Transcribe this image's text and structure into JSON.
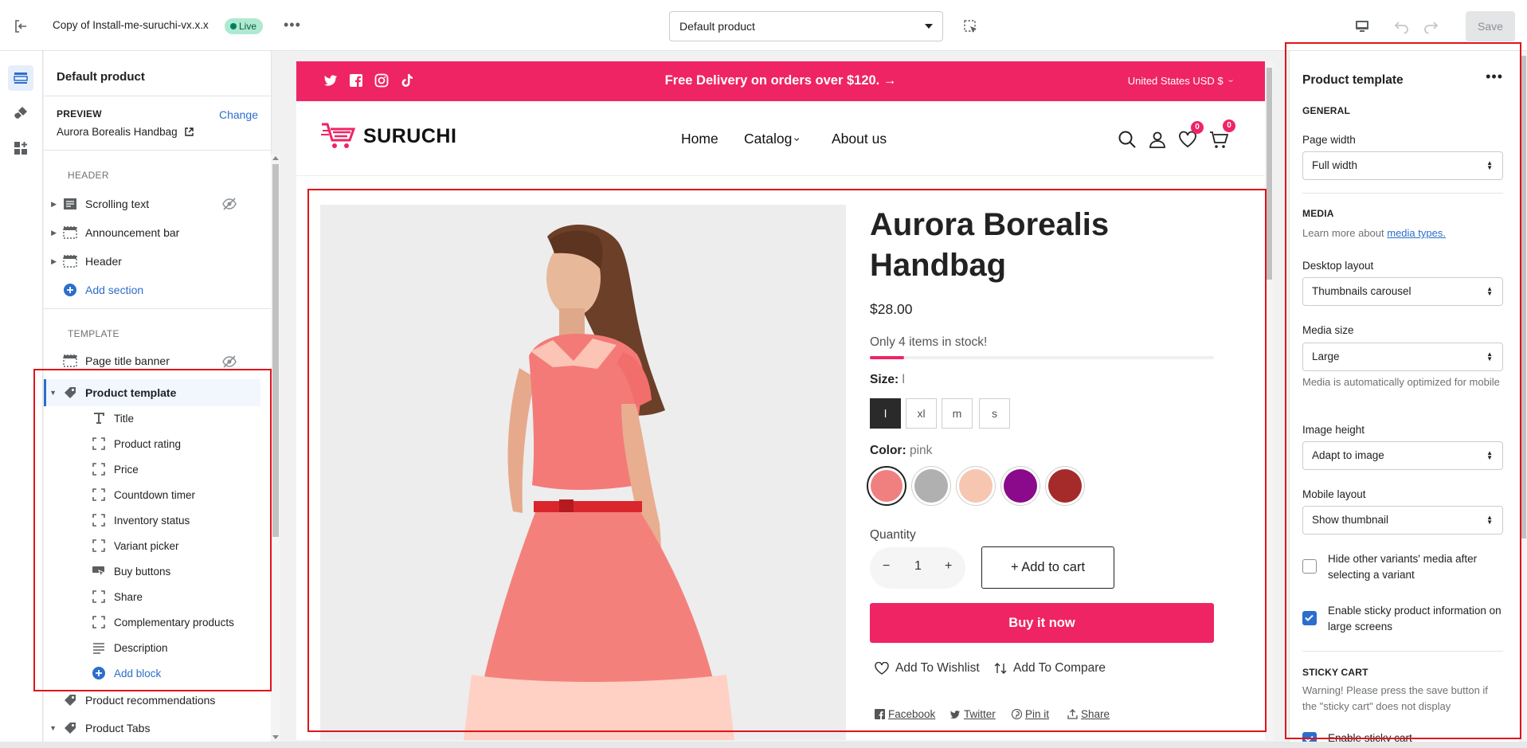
{
  "topbar": {
    "theme_title": "Copy of Install-me-suruchi-vx.x.x",
    "status": "Live",
    "template_select": "Default product",
    "save_label": "Save"
  },
  "left": {
    "heading": "Default product",
    "preview_label": "PREVIEW",
    "change_label": "Change",
    "preview_product": "Aurora Borealis Handbag",
    "header_label": "HEADER",
    "header_items": [
      {
        "label": "Scrolling text",
        "icon": "section-icon"
      },
      {
        "label": "Announcement bar",
        "icon": "section-header-icon"
      },
      {
        "label": "Header",
        "icon": "section-header-icon"
      }
    ],
    "add_section": "Add section",
    "template_label": "TEMPLATE",
    "template_items": [
      {
        "label": "Page title banner"
      },
      {
        "label": "Product template"
      }
    ],
    "blocks": [
      {
        "label": "Title",
        "icon": "text-icon"
      },
      {
        "label": "Product rating",
        "icon": "block-icon"
      },
      {
        "label": "Price",
        "icon": "block-icon"
      },
      {
        "label": "Countdown timer",
        "icon": "block-icon"
      },
      {
        "label": "Inventory status",
        "icon": "block-icon"
      },
      {
        "label": "Variant picker",
        "icon": "block-icon"
      },
      {
        "label": "Buy buttons",
        "icon": "buy-buttons-icon"
      },
      {
        "label": "Share",
        "icon": "block-icon"
      },
      {
        "label": "Complementary products",
        "icon": "block-icon"
      },
      {
        "label": "Description",
        "icon": "description-icon"
      }
    ],
    "add_block": "Add block",
    "after_items": [
      {
        "label": "Product recommendations"
      },
      {
        "label": "Product Tabs"
      }
    ]
  },
  "store": {
    "announcement": "Free Delivery on orders over $120.  →",
    "currency": "United States USD $",
    "logo": "SURUCHI",
    "nav": [
      "Home",
      "Catalog",
      "About us"
    ],
    "wishlist_count": "0",
    "cart_count": "0",
    "product": {
      "title_line1": "Aurora Borealis",
      "title_line2": "Handbag",
      "price": "$28.00",
      "stock_text": "Only 4 items in stock!",
      "stock_fraction": 0.1,
      "size_label": "Size:",
      "size_value": "l",
      "sizes": [
        "l",
        "xl",
        "m",
        "s"
      ],
      "color_label": "Color:",
      "color_value": "pink",
      "swatches": [
        "#f08080",
        "#b0b0b0",
        "#f7c6b0",
        "#8b0a8b",
        "#a52a2a"
      ],
      "quantity_label": "Quantity",
      "quantity": "1",
      "qty_minus": "−",
      "qty_plus": "+",
      "add_to_cart": "+ Add to cart",
      "buy_now": "Buy it now",
      "wishlist": "Add To Wishlist",
      "compare": "Add To Compare",
      "shares": [
        "Facebook",
        "Twitter",
        "Pin it",
        "Share"
      ]
    },
    "accent": "#ef2464"
  },
  "right": {
    "title": "Product template",
    "general": "GENERAL",
    "page_width_label": "Page width",
    "page_width": "Full width",
    "media": "MEDIA",
    "media_help": "Learn more about",
    "media_link": "media types.",
    "desktop_layout_label": "Desktop layout",
    "desktop_layout": "Thumbnails carousel",
    "media_size_label": "Media size",
    "media_size": "Large",
    "media_size_help": "Media is automatically optimized for mobile",
    "image_height_label": "Image height",
    "image_height": "Adapt to image",
    "mobile_layout_label": "Mobile layout",
    "mobile_layout": "Show thumbnail",
    "hide_variants": "Hide other variants' media after selecting a variant",
    "sticky_info": "Enable sticky product information on large screens",
    "sticky_cart": "STICKY CART",
    "sticky_warning": "Warning! Please press the save button if the \"sticky cart\" does not display",
    "enable_sticky": "Enable sticky cart"
  }
}
